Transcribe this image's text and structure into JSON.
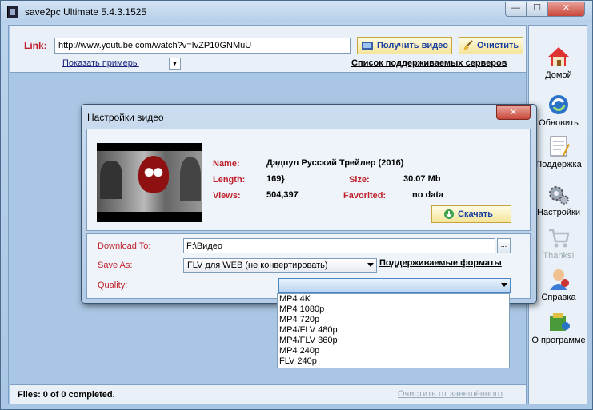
{
  "window": {
    "title": "save2pc Ultimate  5.4.3.1525",
    "min": "—",
    "max": "☐",
    "close": "✕"
  },
  "linkbar": {
    "label": "Link:",
    "url": "http://www.youtube.com/watch?v=IvZP10GNMuU",
    "get_button": "Получить видео",
    "clear_button": "Очистить",
    "examples": "Показать примеры",
    "servers": "Список поддерживаемых серверов"
  },
  "status": {
    "text": "Files: 0 of 0 completed.",
    "clean": "Очистить от завешённого"
  },
  "toolbar": {
    "items": [
      {
        "label": "Домой",
        "icon": "home-icon"
      },
      {
        "label": "Обновить",
        "icon": "refresh-icon"
      },
      {
        "label": "Поддержка",
        "icon": "support-icon"
      },
      {
        "label": "Настройки",
        "icon": "settings-icon"
      },
      {
        "label": "Thanks!",
        "icon": "cart-icon"
      },
      {
        "label": "Справка",
        "icon": "help-icon"
      },
      {
        "label": "О программе",
        "icon": "about-icon"
      }
    ]
  },
  "dialog": {
    "title": "Настройки видео",
    "close": "✕",
    "info": {
      "name_label": "Name:",
      "name": "Дэдпул  Русский Трейлер (2016)",
      "length_label": "Length:",
      "length": "169}",
      "size_label": "Size:",
      "size": "30.07 Mb",
      "views_label": "Views:",
      "views": "504,397",
      "favorited_label": "Favorited:",
      "favorited": "no data"
    },
    "download_button": "Скачать",
    "download_to_label": "Download To:",
    "download_to": "F:\\Видео",
    "browse": "...",
    "save_as_label": "Save As:",
    "save_as": "FLV для WEB (не конвертировать)",
    "formats_link": "Поддерживаемые форматы",
    "quality_label": "Quality:",
    "quality_value": "",
    "quality_options": [
      "MP4 4K",
      "MP4 1080p",
      "MP4 720p",
      "MP4/FLV 480p",
      "MP4/FLV 360p",
      "MP4 240p",
      "FLV 240p"
    ]
  }
}
